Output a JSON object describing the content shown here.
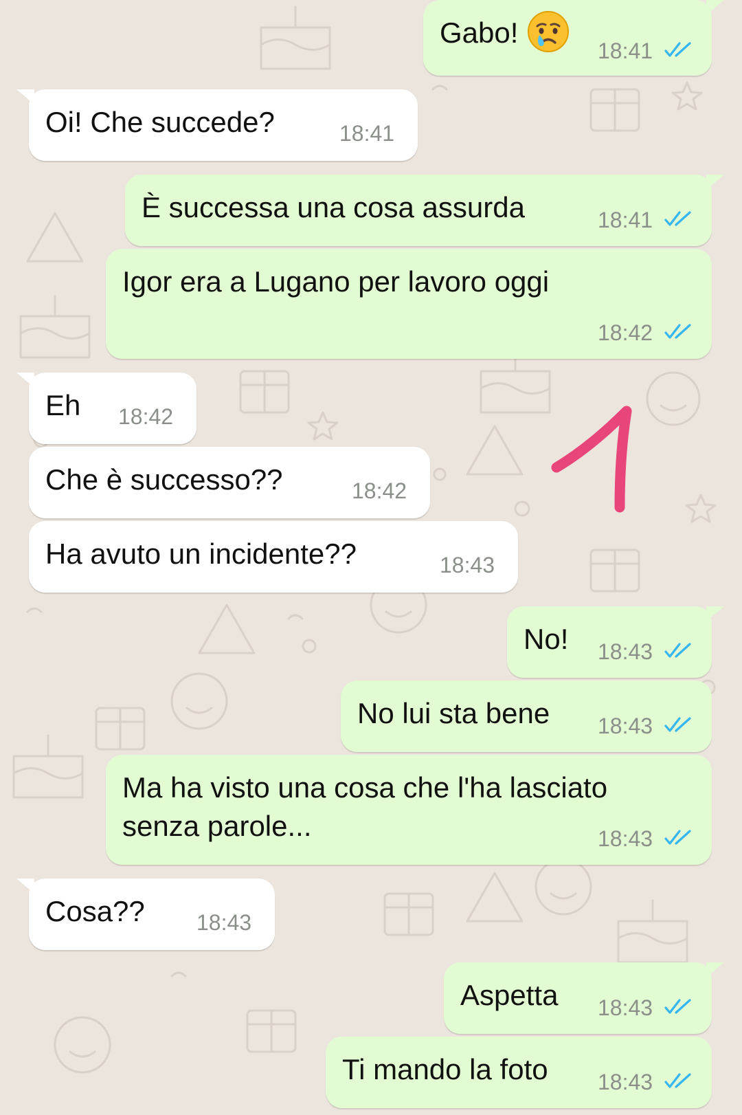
{
  "conversation": {
    "messages": [
      {
        "id": "m1",
        "direction": "out",
        "text": "Gabo!",
        "emoji": "crying-face",
        "time": "18:41",
        "status": "read"
      },
      {
        "id": "m2",
        "direction": "in",
        "text": "Oi! Che succede?",
        "time": "18:41"
      },
      {
        "id": "m3",
        "direction": "out",
        "text": "È successa una cosa assurda",
        "time": "18:41",
        "status": "read"
      },
      {
        "id": "m4",
        "direction": "out",
        "text": "Igor era a Lugano per lavoro oggi",
        "time": "18:42",
        "status": "read"
      },
      {
        "id": "m5",
        "direction": "in",
        "text": "Eh",
        "time": "18:42"
      },
      {
        "id": "m6",
        "direction": "in",
        "text": "Che è successo??",
        "time": "18:42"
      },
      {
        "id": "m7",
        "direction": "in",
        "text": "Ha avuto un incidente??",
        "time": "18:43"
      },
      {
        "id": "m8",
        "direction": "out",
        "text": "No!",
        "time": "18:43",
        "status": "read"
      },
      {
        "id": "m9",
        "direction": "out",
        "text": "No lui sta bene",
        "time": "18:43",
        "status": "read"
      },
      {
        "id": "m10",
        "direction": "out",
        "text": "Ma ha visto una cosa che l'ha lasciato\nsenza parole...",
        "time": "18:43",
        "status": "read"
      },
      {
        "id": "m11",
        "direction": "in",
        "text": "Cosa??",
        "time": "18:43"
      },
      {
        "id": "m12",
        "direction": "out",
        "text": "Aspetta",
        "time": "18:43",
        "status": "read"
      },
      {
        "id": "m13",
        "direction": "out",
        "text": "Ti mando la foto",
        "time": "18:43",
        "status": "read"
      }
    ]
  },
  "theme": {
    "wallpaper_color": "#ece5dd",
    "outgoing_bubble": "#e2fbd3",
    "incoming_bubble": "#ffffff",
    "read_ticks_color": "#34b7f1",
    "annotation_color": "#e8457a"
  },
  "annotation": {
    "icon": "hand-drawn-pink-mark"
  }
}
